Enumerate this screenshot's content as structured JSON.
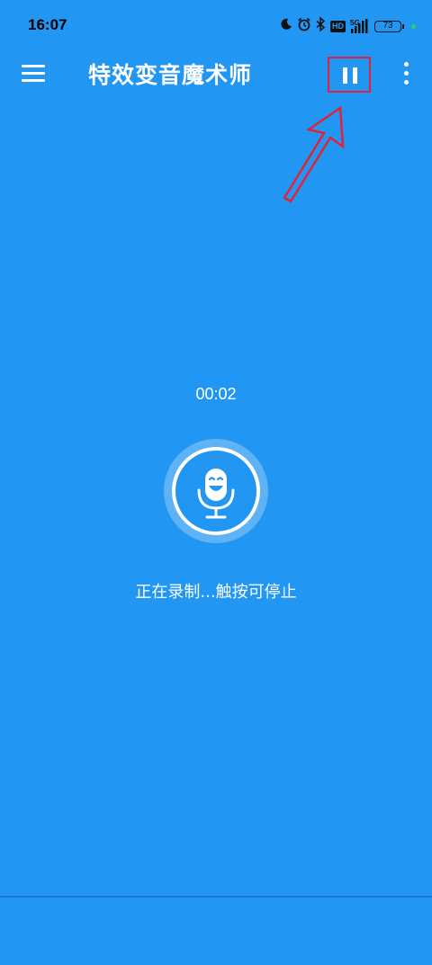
{
  "status_bar": {
    "time": "16:07",
    "icons": [
      "moon-icon",
      "alarm-icon",
      "bluetooth-icon",
      "hd-icon",
      "signal-5g-icon",
      "battery-icon"
    ],
    "network_label": "5G",
    "hd_label": "HD",
    "battery_level": "73"
  },
  "toolbar": {
    "title": "特效变音魔术师",
    "menu_icon": "hamburger-icon",
    "pause_icon": "pause-icon",
    "more_icon": "more-vert-icon"
  },
  "recording": {
    "timer": "00:02",
    "status_text": "正在录制...触按可停止",
    "mic_icon": "smiling-mic-icon"
  },
  "colors": {
    "background": "#2196F3",
    "annotation": "#e0233a",
    "text": "#ffffff"
  }
}
